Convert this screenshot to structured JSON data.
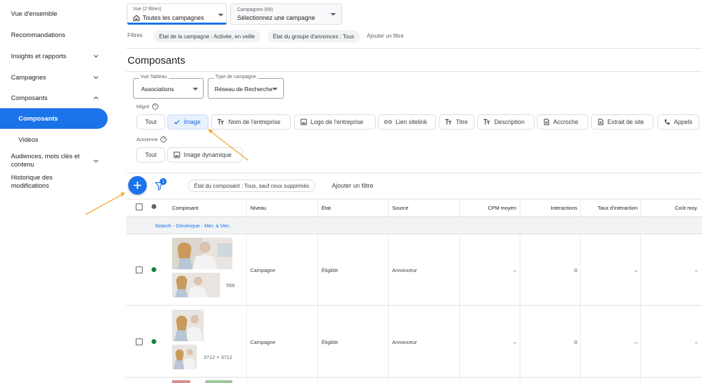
{
  "sidebar": {
    "items": [
      {
        "label": "Vue d'ensemble"
      },
      {
        "label": "Recommandations"
      },
      {
        "label": "Insights et rapports"
      },
      {
        "label": "Campagnes"
      },
      {
        "label": "Composants"
      },
      {
        "label": "Composants"
      },
      {
        "label": "Vidéos"
      },
      {
        "label": "Audiences, mots clés et contenu"
      },
      {
        "label": "Historique des modifications"
      }
    ]
  },
  "topbar": {
    "view": {
      "small": "Vue (2 filtres)",
      "main": "Toutes les campagnes"
    },
    "campaign": {
      "small": "Campagnes (69)",
      "main": "Sélectionnez une campagne"
    },
    "filters_label": "Filtres",
    "filter_pills": [
      "État de la campagne : Activée, en veille",
      "État du groupe d'annonces : Tous"
    ],
    "add_filter": "Ajouter un filtre"
  },
  "page_title": "Composants",
  "selectors": {
    "vue_tableau": {
      "label": "Vue Tableau",
      "value": "Associations"
    },
    "type_campagne": {
      "label": "Type de campagne",
      "value": "Réseau de Recherche"
    }
  },
  "migre": {
    "label": "Migré",
    "chips": [
      "Tout",
      "Image",
      "Nom de l'entreprise",
      "Logo de l'entreprise",
      "Lien sitelink",
      "Titre",
      "Description",
      "Accroche",
      "Extrait de site",
      "Appels"
    ]
  },
  "ancienne": {
    "label": "Ancienne",
    "chips": [
      "Tout",
      "Image dynamique"
    ]
  },
  "toolbar": {
    "filter_badge": "1",
    "filter_pill": "État du composant : Tous, sauf ceux supprimés",
    "add_filter": "Ajouter un filtre"
  },
  "table": {
    "columns": [
      "Composant",
      "Niveau",
      "État",
      "Source",
      "CPM moyen",
      "Interactions",
      "Taux d'interaction",
      "Coût moy."
    ],
    "group_label": "Search - Générique - Mer. à Ven.",
    "rows": [
      {
        "dims": "556",
        "niveau": "Campagne",
        "etat": "Éligible",
        "source": "Annonceur",
        "cpm": "–",
        "interactions": "0",
        "taux": "–",
        "cout": "–"
      },
      {
        "dims": "3712 × 3712",
        "niveau": "Campagne",
        "etat": "Éligible",
        "source": "Annonceur",
        "cpm": "–",
        "interactions": "0",
        "taux": "–",
        "cout": "–"
      }
    ]
  },
  "colors": {
    "accent": "#1a73e8",
    "status_green": "#188038",
    "annotation_arrow": "#f2a73b"
  }
}
